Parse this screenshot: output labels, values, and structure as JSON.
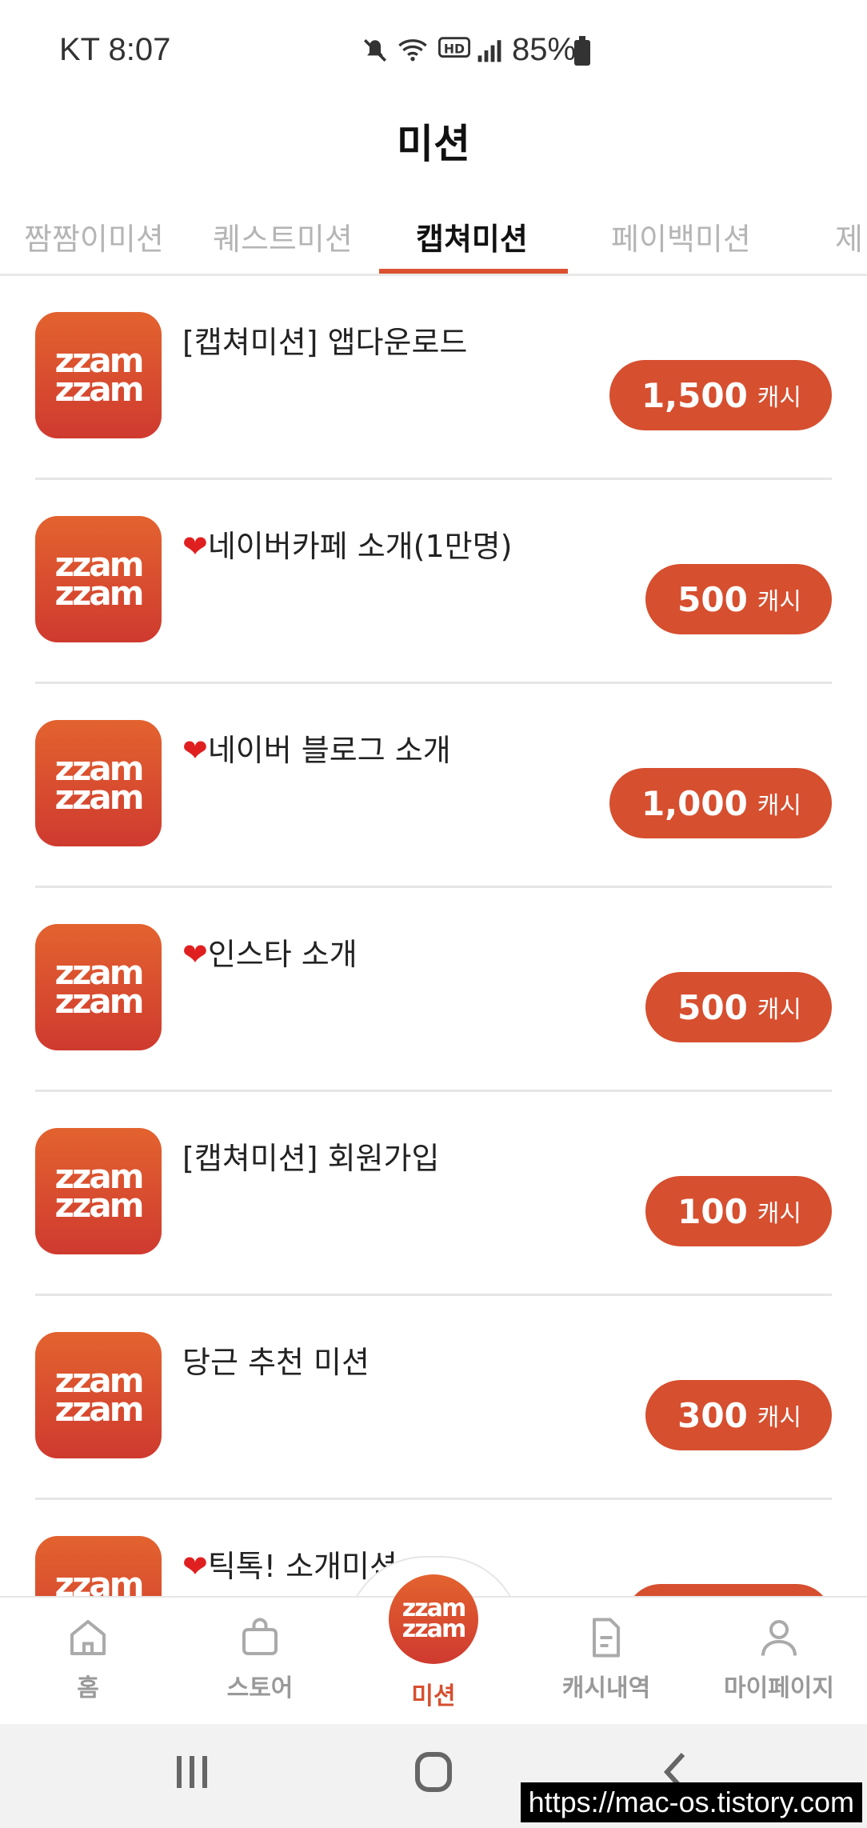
{
  "status_bar": {
    "carrier_time": "KT 8:07",
    "battery": "85%"
  },
  "header": {
    "title": "미션"
  },
  "tabs": [
    {
      "label": "짬짬이미션"
    },
    {
      "label": "퀘스트미션"
    },
    {
      "label": "캡쳐미션"
    },
    {
      "label": "페이백미션"
    },
    {
      "label": "제"
    }
  ],
  "missions": [
    {
      "title": "[캡쳐미션] 앱다운로드",
      "heart": "",
      "amount": "1,500",
      "unit": "캐시"
    },
    {
      "title": "네이버카페 소개(1만명)",
      "heart": "❤",
      "amount": "500",
      "unit": "캐시"
    },
    {
      "title": "네이버 블로그 소개",
      "heart": "❤",
      "amount": "1,000",
      "unit": "캐시"
    },
    {
      "title": "인스타 소개",
      "heart": "❤",
      "amount": "500",
      "unit": "캐시"
    },
    {
      "title": "[캡쳐미션] 회원가입",
      "heart": "",
      "amount": "100",
      "unit": "캐시"
    },
    {
      "title": "당근 추천 미션",
      "heart": "",
      "amount": "300",
      "unit": "캐시"
    },
    {
      "title": "틱톡! 소개미션",
      "heart": "❤",
      "amount": "",
      "unit": ""
    }
  ],
  "app_icon": {
    "line1": "zzam",
    "line2": "zzam"
  },
  "bottom_nav": [
    {
      "label": "홈",
      "icon": "home-icon"
    },
    {
      "label": "스토어",
      "icon": "bag-icon"
    },
    {
      "label": "미션",
      "icon": "zzamzzam-logo"
    },
    {
      "label": "캐시내역",
      "icon": "document-icon"
    },
    {
      "label": "마이페이지",
      "icon": "person-icon"
    }
  ],
  "watermark": "https://mac-os.tistory.com",
  "colors": {
    "accent": "#d64f2f",
    "tab_inactive": "#b5b5b5"
  }
}
